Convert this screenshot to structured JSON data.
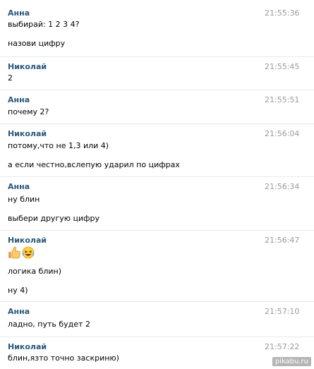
{
  "messages": [
    {
      "author": "Анна",
      "time": "21:55:36",
      "lines": [
        "выбирай: 1 2 3 4?",
        "назови цифру"
      ]
    },
    {
      "author": "Николай",
      "time": "21:55:45",
      "lines": [
        "2"
      ]
    },
    {
      "author": "Анна",
      "time": "21:55:51",
      "lines": [
        "почему 2?"
      ]
    },
    {
      "author": "Николай",
      "time": "21:56:04",
      "lines": [
        "потому,что не 1,3 или 4)",
        "а если честно,вслепую ударил по цифрах"
      ]
    },
    {
      "author": "Анна",
      "time": "21:56:34",
      "lines": [
        "ну блин",
        "выбери другую цифру"
      ]
    },
    {
      "author": "Николай",
      "time": "21:56:47",
      "emojis": [
        "thumbs-up-icon",
        "laughing-tears-icon"
      ],
      "lines": [
        "логика блин)",
        "ну 4)"
      ]
    },
    {
      "author": "Анна",
      "time": "21:57:10",
      "lines": [
        "ладно, путь будет 2"
      ]
    },
    {
      "author": "Николай",
      "time": "21:57:22",
      "lines": [
        "блин,язто точно заскриню)"
      ]
    }
  ],
  "watermark": "pikabu.ru",
  "colors": {
    "author": "#2b587a",
    "time": "#9a9a9a",
    "text": "#000000",
    "divider": "#e7e9ec"
  }
}
